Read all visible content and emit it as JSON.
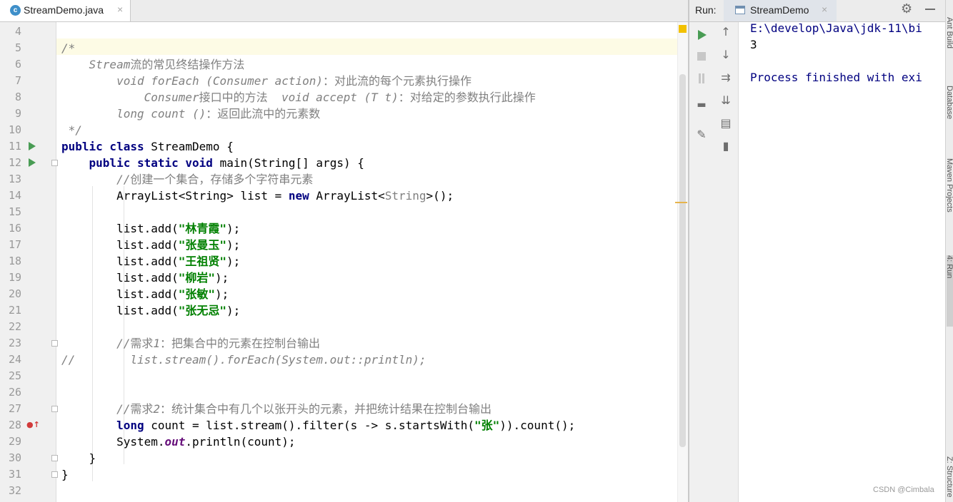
{
  "editor_tab": {
    "label": "StreamDemo.java",
    "icon_letter": "c",
    "close": "×"
  },
  "run_panel": {
    "label": "Run:",
    "tab_label": "StreamDemo",
    "tab_close": "×",
    "output": [
      "E:\\develop\\Java\\jdk-11\\bi",
      "3",
      "",
      "Process finished with exi"
    ]
  },
  "right_toolbar": [
    "Ant Build",
    "Database",
    "Maven Projects",
    "4: Run",
    "Z: Structure"
  ],
  "watermark": "CSDN @Cimbala",
  "line_numbers": [
    "4",
    "5",
    "6",
    "7",
    "8",
    "9",
    "10",
    "11",
    "12",
    "13",
    "14",
    "15",
    "16",
    "17",
    "18",
    "19",
    "20",
    "21",
    "22",
    "23",
    "24",
    "25",
    "26",
    "27",
    "28",
    "29",
    "30",
    "31",
    "32"
  ],
  "code_lines": [
    [],
    [
      [
        "c",
        "/*"
      ]
    ],
    [
      [
        "c",
        "    Stream"
      ],
      [
        "cz",
        "流的常见终结操作方法"
      ]
    ],
    [
      [
        "c",
        "        void forEach (Consumer action)"
      ],
      [
        "cz",
        "：对此流的每个元素执行操作"
      ]
    ],
    [
      [
        "c",
        "            Consumer"
      ],
      [
        "cz",
        "接口中的方法  "
      ],
      [
        "c",
        "void accept (T t)"
      ],
      [
        "cz",
        "：对给定的参数执行此操作"
      ]
    ],
    [
      [
        "c",
        "        long count ()"
      ],
      [
        "cz",
        "：返回此流中的元素数"
      ]
    ],
    [
      [
        "c",
        " */"
      ]
    ],
    [
      [
        "k",
        "public class "
      ],
      [
        "t",
        "StreamDemo {"
      ]
    ],
    [
      [
        "t",
        "    "
      ],
      [
        "k",
        "public static void "
      ],
      [
        "t",
        "main(String[] args) {"
      ]
    ],
    [
      [
        "c",
        "        //"
      ],
      [
        "cz",
        "创建一个集合，存储多个字符串元素"
      ]
    ],
    [
      [
        "t",
        "        ArrayList<String> list = "
      ],
      [
        "k",
        "new "
      ],
      [
        "t",
        "ArrayList<"
      ],
      [
        "g",
        "String"
      ],
      [
        "t",
        ">();"
      ]
    ],
    [],
    [
      [
        "t",
        "        list.add("
      ],
      [
        "s",
        "\"林青霞\""
      ],
      [
        "t",
        ");"
      ]
    ],
    [
      [
        "t",
        "        list.add("
      ],
      [
        "s",
        "\"张曼玉\""
      ],
      [
        "t",
        ");"
      ]
    ],
    [
      [
        "t",
        "        list.add("
      ],
      [
        "s",
        "\"王祖贤\""
      ],
      [
        "t",
        ");"
      ]
    ],
    [
      [
        "t",
        "        list.add("
      ],
      [
        "s",
        "\"柳岩\""
      ],
      [
        "t",
        ");"
      ]
    ],
    [
      [
        "t",
        "        list.add("
      ],
      [
        "s",
        "\"张敏\""
      ],
      [
        "t",
        ");"
      ]
    ],
    [
      [
        "t",
        "        list.add("
      ],
      [
        "s",
        "\"张无忌\""
      ],
      [
        "t",
        ");"
      ]
    ],
    [],
    [
      [
        "c",
        "        //"
      ],
      [
        "cz",
        "需求"
      ],
      [
        "c",
        "1"
      ],
      [
        "cz",
        "：把集合中的元素在控制台输出"
      ]
    ],
    [
      [
        "c",
        "//        list.stream().forEach(System.out::println);"
      ]
    ],
    [],
    [],
    [
      [
        "c",
        "        //"
      ],
      [
        "cz",
        "需求"
      ],
      [
        "c",
        "2"
      ],
      [
        "cz",
        "：统计集合中有几个以张开头的元素，并把统计结果在控制台输出"
      ]
    ],
    [
      [
        "t",
        "        "
      ],
      [
        "k",
        "long "
      ],
      [
        "t",
        "count = list.stream().filter(s -> s.startsWith("
      ],
      [
        "s",
        "\"张\""
      ],
      [
        "t",
        ")).count();"
      ]
    ],
    [
      [
        "t",
        "        System."
      ],
      [
        "f",
        "out"
      ],
      [
        "t",
        ".println(count);"
      ]
    ],
    [
      [
        "t",
        "    }"
      ]
    ],
    [
      [
        "t",
        "}"
      ]
    ],
    []
  ]
}
